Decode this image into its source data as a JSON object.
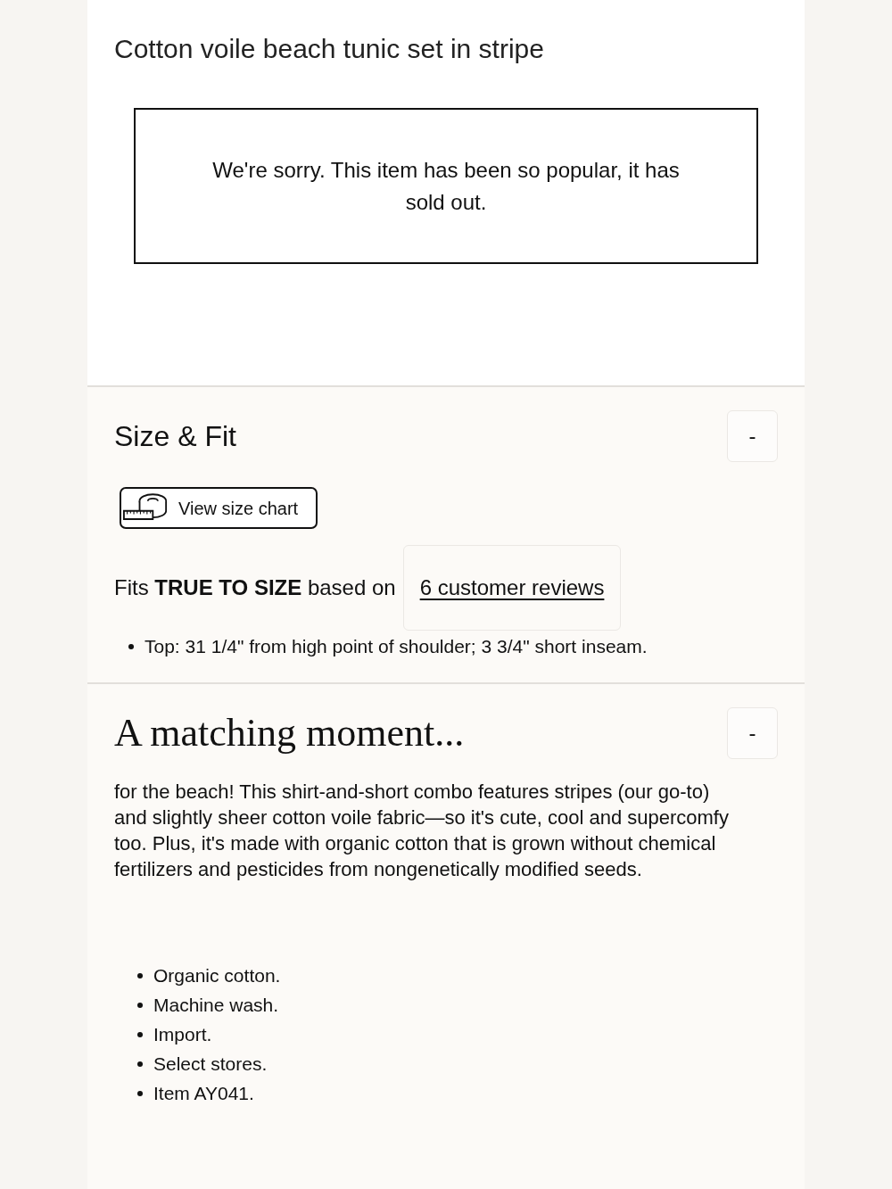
{
  "product": {
    "title": "Cotton voile beach tunic set in stripe"
  },
  "notice": {
    "text": "We're sorry. This item has been so popular, it has sold out."
  },
  "sections": [
    {
      "kind": "size_fit",
      "title": "Size & Fit",
      "expanded": true,
      "toggle": "-",
      "size_chart_button": "View size chart",
      "fit_text": "Fits **TRUE TO SIZE** based on",
      "reviews_link": "6 customer reviews",
      "bullets": [
        "Top: 31 1/4\" from high point of shoulder; 3 3/4\" short inseam."
      ]
    },
    {
      "kind": "description",
      "title": "A matching moment...",
      "expanded": true,
      "toggle": "-",
      "paragraph": "for the beach! This shirt-and-short combo features stripes (our go-to) and slightly sheer cotton voile fabric—so it's cute, cool and supercomfy too. Plus, it's made with organic cotton that is grown without chemical fertilizers and pesticides from nongenetically modified seeds.",
      "bullets": [
        "Organic cotton.",
        "Machine wash.",
        "Import.",
        "Select stores.",
        "Item AY041."
      ]
    }
  ]
}
